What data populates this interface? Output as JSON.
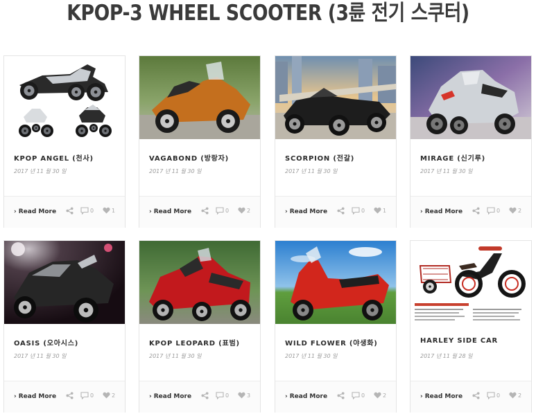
{
  "page": {
    "title": "KPOP-3 WHEEL SCOOTER (3륜 전기 스쿠터)"
  },
  "footer_labels": {
    "read_more": "Read More"
  },
  "colors": {
    "title": "#3a3a3a",
    "card_border": "#e4e4e4",
    "meta": "#a8a8a8"
  },
  "cards": [
    {
      "title": "KPOP ANGEL (천사)",
      "date": "2017 년 11 월 30 일",
      "comments": "0",
      "likes": "1",
      "image": "silver-three-wheel-scooter-collage"
    },
    {
      "title": "VAGABOND (방랑자)",
      "date": "2017 년 11 월 30 일",
      "comments": "0",
      "likes": "2",
      "image": "orange-trike-roadster"
    },
    {
      "title": "SCORPION (전갈)",
      "date": "2017 년 11 월 30 일",
      "comments": "0",
      "likes": "1",
      "image": "black-open-three-wheeler-city"
    },
    {
      "title": "MIRAGE (신기루)",
      "date": "2017 년 11 월 30 일",
      "comments": "0",
      "likes": "2",
      "image": "silver-maxi-trike-scooter"
    },
    {
      "title": "OASIS (오아시스)",
      "date": "2017 년 11 월 30 일",
      "comments": "0",
      "likes": "2",
      "image": "black-futuristic-trike-studio"
    },
    {
      "title": "KPOP LEOPARD (표범)",
      "date": "2017 년 11 월 30 일",
      "comments": "0",
      "likes": "3",
      "image": "red-touring-trike"
    },
    {
      "title": "WILD FLOWER (야생화)",
      "date": "2017 년 11 월 30 일",
      "comments": "0",
      "likes": "2",
      "image": "red-black-scooter-outdoors"
    },
    {
      "title": "HARLEY SIDE CAR",
      "date": "2017 년 11 월 28 일",
      "comments": "0",
      "likes": "2",
      "image": "red-bike-with-sidecar-spec-sheet"
    }
  ]
}
